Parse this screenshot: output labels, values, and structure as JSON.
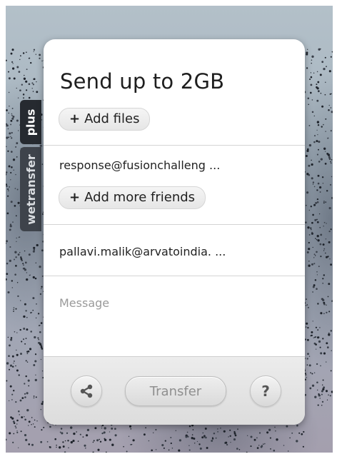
{
  "sidebar": {
    "plus_label": "plus",
    "brand_label": "wetransfer"
  },
  "card": {
    "title": "Send up to 2GB",
    "add_files_label": "Add files",
    "friends_email": "response@fusionchalleng ...",
    "add_friends_label": "Add more friends",
    "your_email": "pallavi.malik@arvatoindia. ...",
    "message_placeholder": "Message"
  },
  "footer": {
    "share_icon": "share-icon",
    "transfer_label": "Transfer",
    "help_label": "?"
  },
  "colors": {
    "card_bg": "#ffffff",
    "tab_dark": "#262a30",
    "tab_gray": "#3e434b",
    "button_text": "#8f8f8f"
  }
}
